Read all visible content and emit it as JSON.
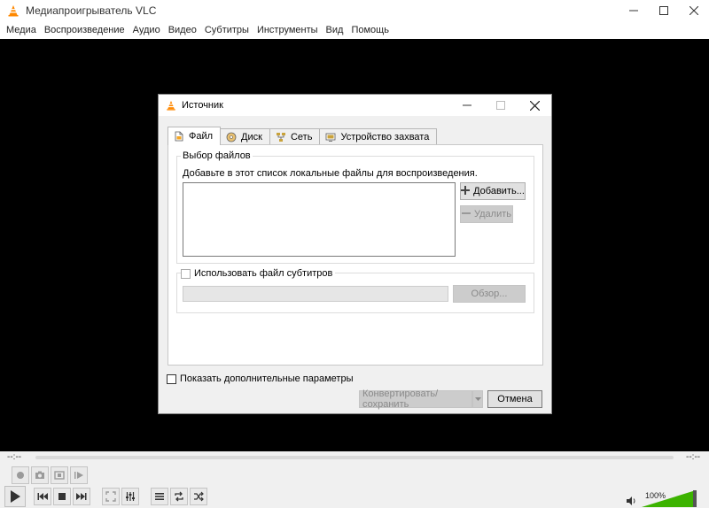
{
  "app": {
    "title": "Медиапроигрыватель VLC"
  },
  "menu": {
    "items": [
      "Медиа",
      "Воспроизведение",
      "Аудио",
      "Видео",
      "Субтитры",
      "Инструменты",
      "Вид",
      "Помощь"
    ]
  },
  "dialog": {
    "title": "Источник",
    "tabs": [
      {
        "label": "Файл",
        "icon": "file-icon",
        "active": true
      },
      {
        "label": "Диск",
        "icon": "disc-icon",
        "active": false
      },
      {
        "label": "Сеть",
        "icon": "network-icon",
        "active": false
      },
      {
        "label": "Устройство захвата",
        "icon": "capture-device-icon",
        "active": false
      }
    ],
    "file_group_label": "Выбор файлов",
    "file_hint": "Добавьте в этот список локальные файлы для воспроизведения.",
    "add_button": "Добавить...",
    "remove_button": "Удалить",
    "subtitle_checkbox_label": "Использовать файл субтитров",
    "browse_button": "Обзор...",
    "show_more_label": "Показать дополнительные параметры",
    "convert_button": "Конвертировать/сохранить",
    "cancel_button": "Отмена"
  },
  "player": {
    "elapsed": "--:--",
    "remaining": "--:--",
    "volume": "100%",
    "volume_level": 1.0
  },
  "colors": {
    "video_bg": "#000000",
    "vlc_orange": "#ff8800",
    "volume_green": "#3cb300"
  }
}
